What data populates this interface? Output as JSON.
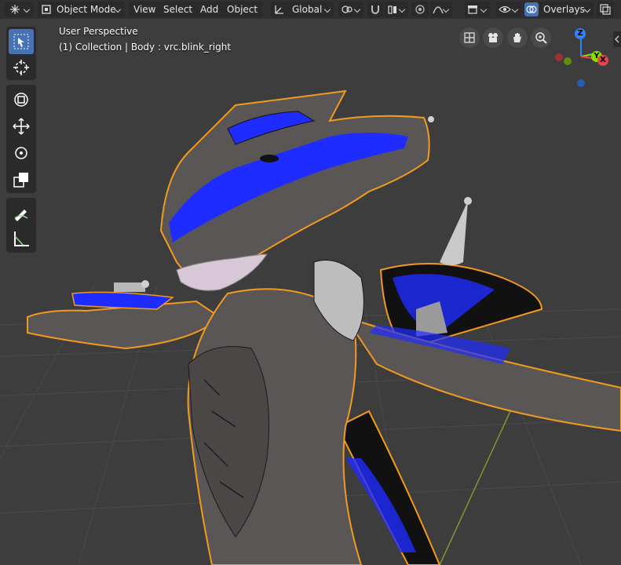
{
  "header": {
    "mode_label": "Object Mode",
    "menus": [
      "View",
      "Select",
      "Add",
      "Object"
    ],
    "transform_orientation": "Global",
    "overlays_label": "Overlays"
  },
  "viewport": {
    "perspective_label": "User Perspective",
    "object_info": "(1) Collection | Body : vrc.blink_right"
  },
  "toolbar": {
    "tools": [
      "select-box",
      "cursor",
      "move",
      "rotate",
      "scale",
      "transform",
      "annotate",
      "measure"
    ],
    "active_tool": "select-box"
  },
  "nav_gizmo": {
    "axes": [
      "X",
      "Y",
      "Z"
    ],
    "colors": {
      "x": "#e8434c",
      "y": "#8bdc00",
      "z": "#2f83ff"
    }
  },
  "colors": {
    "accent": "#4772b3",
    "selection_outline": "#f29a1f",
    "feather_blue": "#1f2cff",
    "model_gray": "#5b5656"
  }
}
